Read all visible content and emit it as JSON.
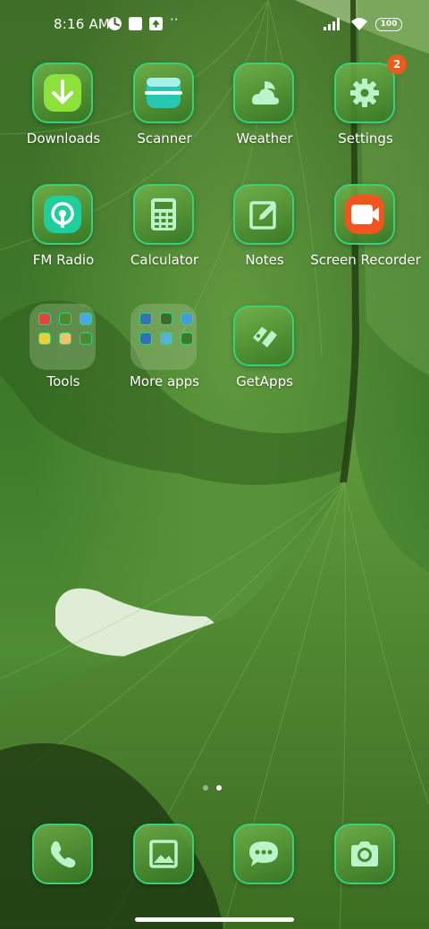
{
  "status_bar": {
    "time": "8:16 AM",
    "battery": "100",
    "more": "··"
  },
  "apps": [
    {
      "label": "Downloads",
      "icon": "downloads-icon"
    },
    {
      "label": "Scanner",
      "icon": "scanner-icon"
    },
    {
      "label": "Weather",
      "icon": "weather-icon"
    },
    {
      "label": "Settings",
      "icon": "gear-icon",
      "badge": "2"
    },
    {
      "label": "FM Radio",
      "icon": "radio-icon"
    },
    {
      "label": "Calculator",
      "icon": "calculator-icon"
    },
    {
      "label": "Notes",
      "icon": "notes-icon"
    },
    {
      "label": "Screen Recorder",
      "icon": "screen-recorder-icon"
    },
    {
      "label": "Tools",
      "icon": "folder-icon"
    },
    {
      "label": "More apps",
      "icon": "folder-icon"
    },
    {
      "label": "GetApps",
      "icon": "getapps-icon"
    }
  ],
  "dock": [
    {
      "icon": "phone-icon"
    },
    {
      "icon": "gallery-icon"
    },
    {
      "icon": "messages-icon"
    },
    {
      "icon": "camera-icon"
    }
  ],
  "page_indicator": {
    "pages": 2,
    "current": 2
  },
  "colors": {
    "accent_green": "#35d27c",
    "icon_glyph": "#b9f5c9",
    "badge": "#ee5a1c"
  }
}
